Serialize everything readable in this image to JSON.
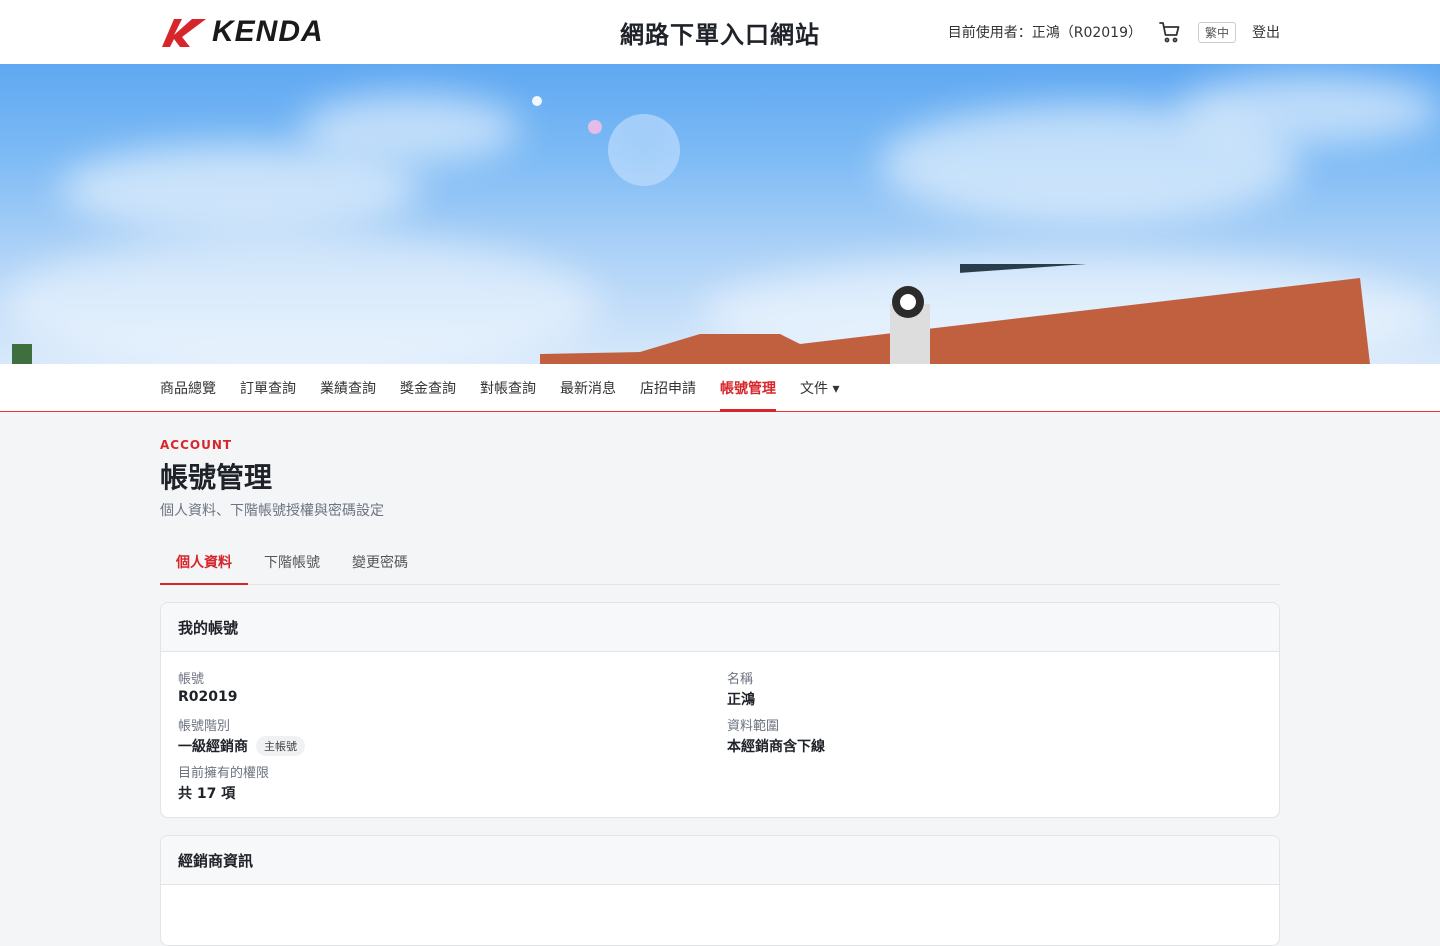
{
  "header": {
    "logo_text": "KENDA",
    "site_title": "網路下單入口網站",
    "user_label": "目前使用者：正鴻（R02019）",
    "cart_icon": "cart-icon",
    "lang": "繁中",
    "logout": "登出"
  },
  "nav": {
    "items": [
      {
        "label": "商品總覽"
      },
      {
        "label": "訂單查詢"
      },
      {
        "label": "業績查詢"
      },
      {
        "label": "獎金查詢"
      },
      {
        "label": "對帳查詢"
      },
      {
        "label": "最新消息"
      },
      {
        "label": "店招申請"
      },
      {
        "label": "帳號管理"
      },
      {
        "label": "文件 ▾"
      }
    ],
    "active_index": 7
  },
  "page": {
    "eyebrow": "ACCOUNT",
    "title": "帳號管理",
    "subtitle": "個人資料、下階帳號授權與密碼設定"
  },
  "tabs": [
    {
      "label": "個人資料"
    },
    {
      "label": "下階帳號"
    },
    {
      "label": "變更密碼"
    }
  ],
  "account_card": {
    "title": "我的帳號",
    "account_label": "帳號",
    "account_value": "R02019",
    "name_label": "名稱",
    "name_value": "正鴻",
    "level_label": "帳號階別",
    "level_value": "一級經銷商",
    "level_badge": "主帳號",
    "scope_label": "資料範圍",
    "scope_value": "本經銷商含下線",
    "perm_label": "目前擁有的權限",
    "perm_value": "共 17 項"
  },
  "dealer_card": {
    "title": "經銷商資訊"
  },
  "colors": {
    "accent": "#d7262b",
    "page_bg": "#f4f5f7"
  }
}
